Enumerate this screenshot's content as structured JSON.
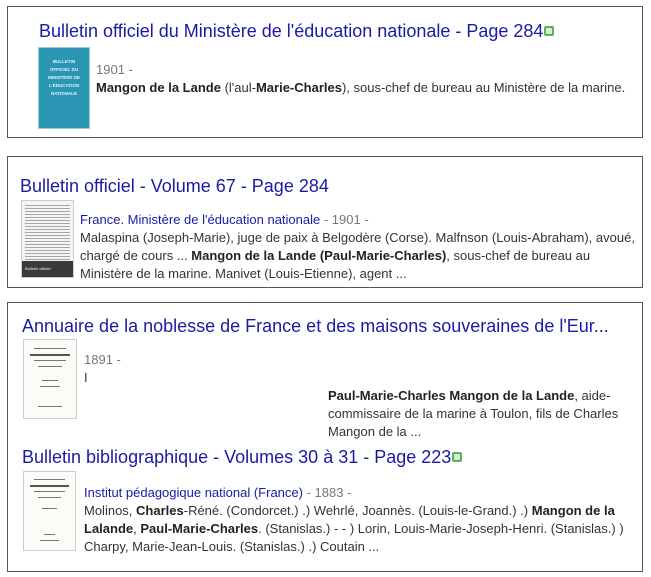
{
  "results": [
    {
      "title": "Bulletin officiel du Ministère de l'éducation nationale - Page 284",
      "has_ebook_icon": true,
      "cover_text": "BULLETIN OFFICIEL DU MINISTÈRE DE L'ÉDUCATION NATIONALE",
      "source": "",
      "year": "1901 -",
      "snippet": [
        {
          "t": "Mangon de la Lande",
          "b": true
        },
        {
          "t": " (l'aul-",
          "b": false
        },
        {
          "t": "Marie-Charles",
          "b": true
        },
        {
          "t": "), sous-chef de bureau au Ministère de la marine.",
          "b": false
        }
      ]
    },
    {
      "title": "Bulletin officiel - Volume 67 - Page 284",
      "has_ebook_icon": false,
      "cover_text": "Bulletin officiel",
      "source": "France. Ministère de l'éducation nationale",
      "year": " - 1901 -",
      "snippet": [
        {
          "t": "Malaspina (Joseph-Marie), juge de paix à Belgodère (Corse). Malfnson (Louis-Abraham), avoué, chargé de cours ... ",
          "b": false
        },
        {
          "t": "Mangon de la Lande (Paul-Marie-Charles)",
          "b": true
        },
        {
          "t": ", sous-chef de bureau au Ministère de la marine. Manivet (Louis-Etienne), agent ...",
          "b": false
        }
      ]
    },
    {
      "title": "Annuaire de la noblesse de France et des maisons souveraines de l'Eur...",
      "has_ebook_icon": false,
      "source": "",
      "year": "1891 -",
      "mark": "I",
      "snippet": [
        {
          "t": "Paul-Marie-Charles Mangon de la Lande",
          "b": true
        },
        {
          "t": ", aide-commissaire de la marine à Toulon, fils de Charles Mangon de la ...",
          "b": false
        }
      ]
    },
    {
      "title": "Bulletin bibliographique - Volumes 30 à 31 - Page 223",
      "has_ebook_icon": true,
      "source": "Institut pédagogique national (France)",
      "year": " - 1883 -",
      "snippet": [
        {
          "t": "Molinos, ",
          "b": false
        },
        {
          "t": "Charles",
          "b": true
        },
        {
          "t": "-Réné. (Condorcet.) .) Wehrlé, Joannès. (Louis-le-Grand.) .) ",
          "b": false
        },
        {
          "t": "Mangon de la Lalande",
          "b": true
        },
        {
          "t": ", ",
          "b": false
        },
        {
          "t": "Paul-Marie-Charles",
          "b": true
        },
        {
          "t": ". (Stanislas.) - - ) Lorin, Louis-Marie-Joseph-Henri. (Stanislas.) ) Charpy, Marie-Jean-Louis. (Stanislas.) .) Coutain ...",
          "b": false
        }
      ]
    }
  ]
}
